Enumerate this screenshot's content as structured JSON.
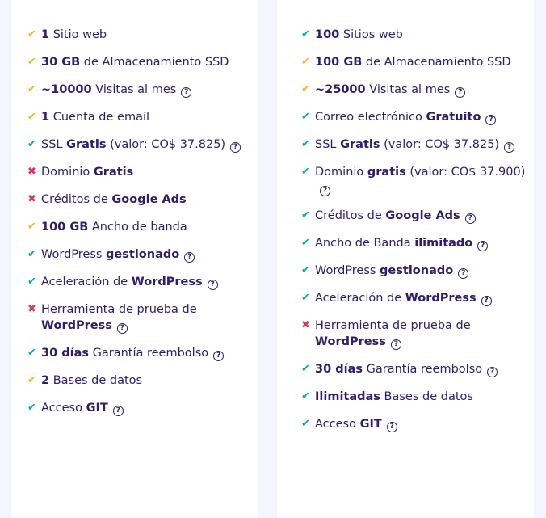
{
  "colors": {
    "check_green": "#00b090",
    "check_orange": "#ffb025",
    "cross_red": "#e0345a",
    "text": "#2f1c6a"
  },
  "left_plan": {
    "features": [
      {
        "icon": "check-orange-icon",
        "parts": [
          {
            "text": "1",
            "b": true
          },
          {
            "text": " Sitio web"
          }
        ],
        "help": false
      },
      {
        "icon": "check-orange-icon",
        "parts": [
          {
            "text": "30 GB",
            "b": true
          },
          {
            "text": " de Almacenamiento SSD"
          }
        ],
        "help": false
      },
      {
        "icon": "check-orange-icon",
        "parts": [
          {
            "text": "~10000",
            "b": true
          },
          {
            "text": " Visitas al mes"
          }
        ],
        "help": true
      },
      {
        "icon": "check-orange-icon",
        "parts": [
          {
            "text": "1",
            "b": true
          },
          {
            "text": " Cuenta de email"
          }
        ],
        "help": false
      },
      {
        "icon": "check-green-icon",
        "parts": [
          {
            "text": "SSL "
          },
          {
            "text": "Gratis",
            "b": true
          },
          {
            "text": " (valor: CO$ 37.825)"
          }
        ],
        "help": true
      },
      {
        "icon": "cross-icon",
        "parts": [
          {
            "text": "Dominio "
          },
          {
            "text": "Gratis",
            "b": true
          }
        ],
        "help": false
      },
      {
        "icon": "cross-icon",
        "parts": [
          {
            "text": "Créditos de "
          },
          {
            "text": "Google Ads",
            "b": true
          }
        ],
        "help": false
      },
      {
        "icon": "check-orange-icon",
        "parts": [
          {
            "text": "100 GB",
            "b": true
          },
          {
            "text": " Ancho de banda"
          }
        ],
        "help": false
      },
      {
        "icon": "check-green-icon",
        "parts": [
          {
            "text": "WordPress "
          },
          {
            "text": "gestionado",
            "b": true
          }
        ],
        "help": true
      },
      {
        "icon": "check-green-icon",
        "parts": [
          {
            "text": "Aceleración de "
          },
          {
            "text": "WordPress",
            "b": true
          }
        ],
        "help": true
      },
      {
        "icon": "cross-icon",
        "parts": [
          {
            "text": "Herramienta de prueba de "
          },
          {
            "text": "WordPress",
            "b": true
          }
        ],
        "help": true
      },
      {
        "icon": "check-green-icon",
        "parts": [
          {
            "text": "30 días",
            "b": true
          },
          {
            "text": " Garantía reembolso"
          }
        ],
        "help": true
      },
      {
        "icon": "check-orange-icon",
        "parts": [
          {
            "text": "2",
            "b": true
          },
          {
            "text": " Bases de datos"
          }
        ],
        "help": false
      },
      {
        "icon": "check-green-icon",
        "parts": [
          {
            "text": "Acceso "
          },
          {
            "text": "GIT",
            "b": true
          }
        ],
        "help": true
      }
    ]
  },
  "right_plan": {
    "features": [
      {
        "icon": "check-green-icon",
        "parts": [
          {
            "text": "100",
            "b": true
          },
          {
            "text": " Sitios web"
          }
        ],
        "help": false
      },
      {
        "icon": "check-orange-icon",
        "parts": [
          {
            "text": "100 GB",
            "b": true
          },
          {
            "text": " de Almacenamiento SSD"
          }
        ],
        "help": false
      },
      {
        "icon": "check-orange-icon",
        "parts": [
          {
            "text": "~25000",
            "b": true
          },
          {
            "text": " Visitas al mes"
          }
        ],
        "help": true
      },
      {
        "icon": "check-green-icon",
        "parts": [
          {
            "text": "Correo electrónico "
          },
          {
            "text": "Gratuito",
            "b": true
          }
        ],
        "help": true
      },
      {
        "icon": "check-green-icon",
        "parts": [
          {
            "text": "SSL "
          },
          {
            "text": "Gratis",
            "b": true
          },
          {
            "text": " (valor: CO$ 37.825)"
          }
        ],
        "help": true
      },
      {
        "icon": "check-green-icon",
        "parts": [
          {
            "text": "Dominio "
          },
          {
            "text": "gratis",
            "b": true
          },
          {
            "text": " (valor: CO$ 37.900)"
          }
        ],
        "help": true
      },
      {
        "icon": "check-green-icon",
        "parts": [
          {
            "text": "Créditos de "
          },
          {
            "text": "Google Ads",
            "b": true
          }
        ],
        "help": true
      },
      {
        "icon": "check-green-icon",
        "parts": [
          {
            "text": "Ancho de Banda "
          },
          {
            "text": "ilimitado",
            "b": true
          }
        ],
        "help": true
      },
      {
        "icon": "check-green-icon",
        "parts": [
          {
            "text": "WordPress "
          },
          {
            "text": "gestionado",
            "b": true
          }
        ],
        "help": true
      },
      {
        "icon": "check-green-icon",
        "parts": [
          {
            "text": "Aceleración de "
          },
          {
            "text": "WordPress",
            "b": true
          }
        ],
        "help": true
      },
      {
        "icon": "cross-icon",
        "parts": [
          {
            "text": "Herramienta de prueba de "
          },
          {
            "text": "WordPress",
            "b": true
          }
        ],
        "help": true
      },
      {
        "icon": "check-green-icon",
        "parts": [
          {
            "text": "30 días",
            "b": true
          },
          {
            "text": " Garantía reembolso"
          }
        ],
        "help": true
      },
      {
        "icon": "check-green-icon",
        "parts": [
          {
            "text": "Ilimitadas",
            "b": true
          },
          {
            "text": " Bases de datos"
          }
        ],
        "help": false
      },
      {
        "icon": "check-green-icon",
        "parts": [
          {
            "text": "Acceso "
          },
          {
            "text": "GIT",
            "b": true
          }
        ],
        "help": true
      }
    ]
  }
}
